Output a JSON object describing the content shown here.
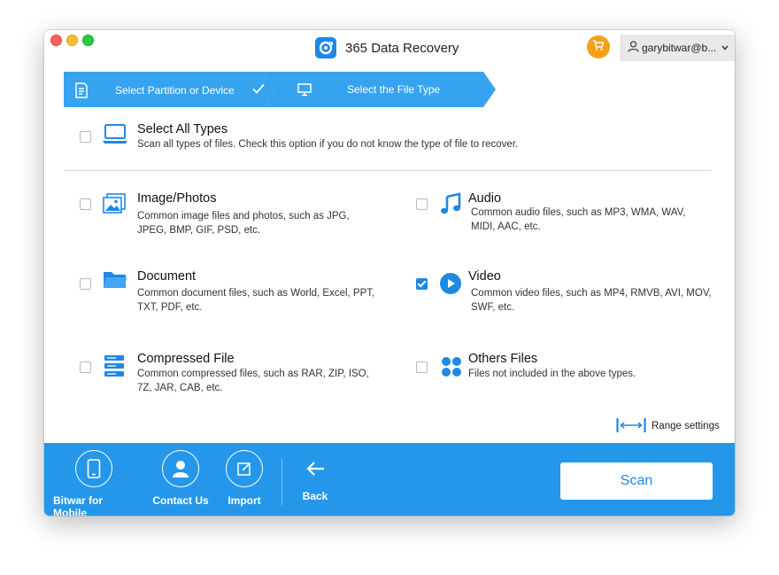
{
  "window": {
    "title": "365 Data Recovery",
    "user_label": "garybitwar@b...",
    "icons": {
      "logo": "recovery-logo-icon",
      "cart": "cart-icon",
      "user": "user-icon",
      "chevron": "chevron-down-icon"
    }
  },
  "steps": [
    {
      "label": "Select Partition or Device",
      "icon": "document-icon",
      "status": "completed"
    },
    {
      "label": "Select the File Type",
      "icon": "monitor-icon",
      "status": "active"
    }
  ],
  "select_all": {
    "title": "Select All Types",
    "description": "Scan all types of files. Check this option if you do not know the type of file to recover.",
    "checked": false,
    "icon": "laptop-icon"
  },
  "file_types": [
    {
      "id": "image",
      "title": "Image/Photos",
      "desc1": "Common image files and photos, such as JPG,",
      "desc2": "JPEG, BMP, GIF, PSD, etc.",
      "checked": false,
      "icon": "image-icon"
    },
    {
      "id": "audio",
      "title": "Audio",
      "desc1": "Common audio files, such as MP3, WMA, WAV,",
      "desc2": "MIDI, AAC, etc.",
      "checked": false,
      "icon": "music-note-icon"
    },
    {
      "id": "document",
      "title": "Document",
      "desc1": "Common document files, such as World, Excel, PPT,",
      "desc2": "TXT, PDF, etc.",
      "checked": false,
      "icon": "folder-icon"
    },
    {
      "id": "video",
      "title": "Video",
      "desc1": "Common video files, such as MP4, RMVB, AVI, MOV,",
      "desc2": "SWF, etc.",
      "checked": true,
      "icon": "play-icon"
    },
    {
      "id": "compressed",
      "title": "Compressed File",
      "desc1": "Common compressed files, such as RAR, ZIP, ISO,",
      "desc2": "7Z, JAR, CAB, etc.",
      "checked": false,
      "icon": "archive-stack-icon"
    },
    {
      "id": "others",
      "title": "Others Files",
      "desc1": "Files not included in the above types.",
      "desc2": "",
      "checked": false,
      "icon": "grid-dots-icon"
    }
  ],
  "range_settings": {
    "label": "Range settings",
    "icon": "range-arrows-icon"
  },
  "footer": {
    "mobile": "Bitwar for Mobile",
    "contact": "Contact Us",
    "import": "Import",
    "back": "Back",
    "scan": "Scan",
    "colors": {
      "bar": "#2597ea",
      "accent": "#1e88e5"
    }
  }
}
